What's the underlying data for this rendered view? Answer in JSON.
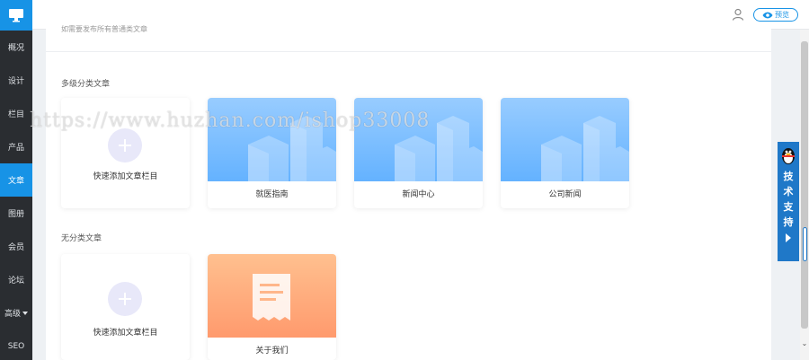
{
  "sidebar": {
    "items": [
      {
        "label": "概况"
      },
      {
        "label": "设计"
      },
      {
        "label": "栏目"
      },
      {
        "label": "产品"
      },
      {
        "label": "文章",
        "active": true
      },
      {
        "label": "图册"
      },
      {
        "label": "会员"
      },
      {
        "label": "论坛"
      },
      {
        "label": "高级"
      },
      {
        "label": "SEO"
      }
    ]
  },
  "header": {
    "preview_label": "预览"
  },
  "main": {
    "hint": "如需要发布所有普通类文章",
    "multi_section": {
      "title": "多级分类文章",
      "add_label": "快速添加文章栏目",
      "categories": [
        "就医指南",
        "新闻中心",
        "公司新闻"
      ]
    },
    "uncat_section": {
      "title": "无分类文章",
      "add_label": "快速添加文章栏目",
      "categories": [
        "关于我们"
      ]
    }
  },
  "support": {
    "label": "技术支持"
  },
  "watermark": "https://www.huzhan.com/ishop33008",
  "colors": {
    "accent": "#1793e6",
    "sidebar_bg": "#2a2d31",
    "card_blue": "#64b2ff",
    "card_orange": "#ff9a6d"
  }
}
